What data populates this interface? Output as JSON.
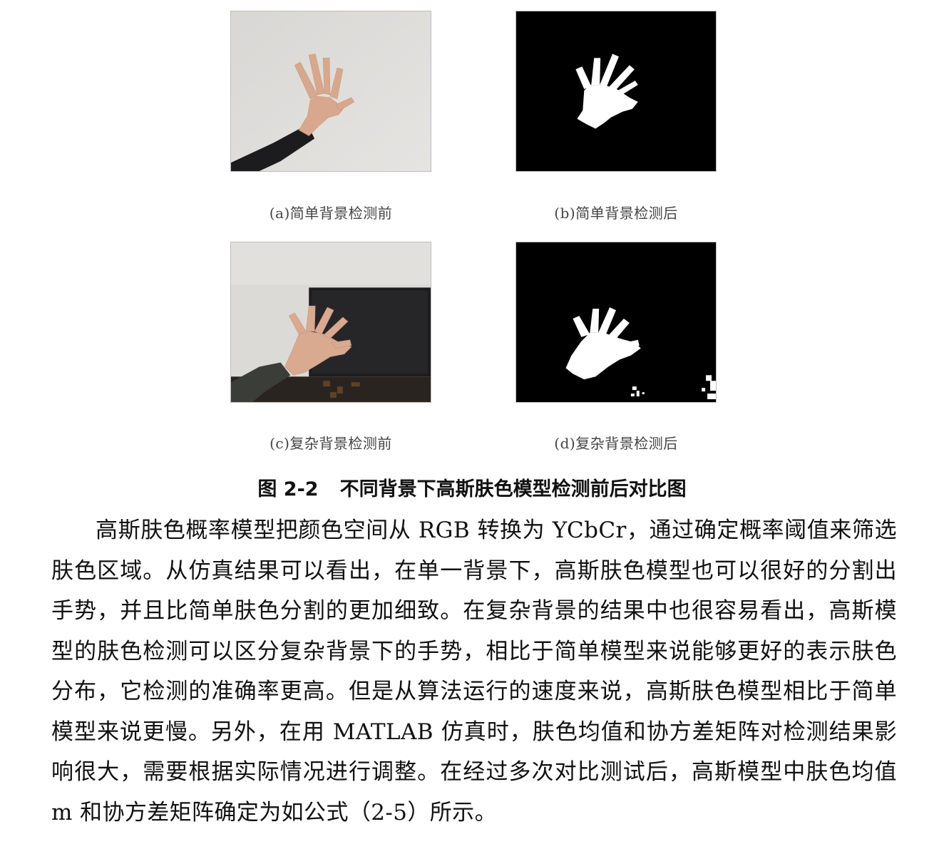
{
  "figure": {
    "number": "图 2-2",
    "title": "不同背景下高斯肤色模型检测前后对比图",
    "panels": [
      {
        "caption": "(a)简单背景检测前"
      },
      {
        "caption": "(b)简单背景检测后"
      },
      {
        "caption": "(c)复杂背景检测前"
      },
      {
        "caption": "(d)复杂背景检测后"
      }
    ]
  },
  "paragraph": "高斯肤色概率模型把颜色空间从 RGB 转换为 YCbCr，通过确定概率阈值来筛选肤色区域。从仿真结果可以看出，在单一背景下，高斯肤色模型也可以很好的分割出手势，并且比简单肤色分割的更加细致。在复杂背景的结果中也很容易看出，高斯模型的肤色检测可以区分复杂背景下的手势，相比于简单模型来说能够更好的表示肤色分布，它检测的准确率更高。但是从算法运行的速度来说，高斯肤色模型相比于简单模型来说更慢。另外，在用 MATLAB 仿真时，肤色均值和协方差矩阵对检测结果影响很大，需要根据实际情况进行调整。在经过多次对比测试后，高斯模型中肤色均值 m 和协方差矩阵确定为如公式（2-5）所示。"
}
